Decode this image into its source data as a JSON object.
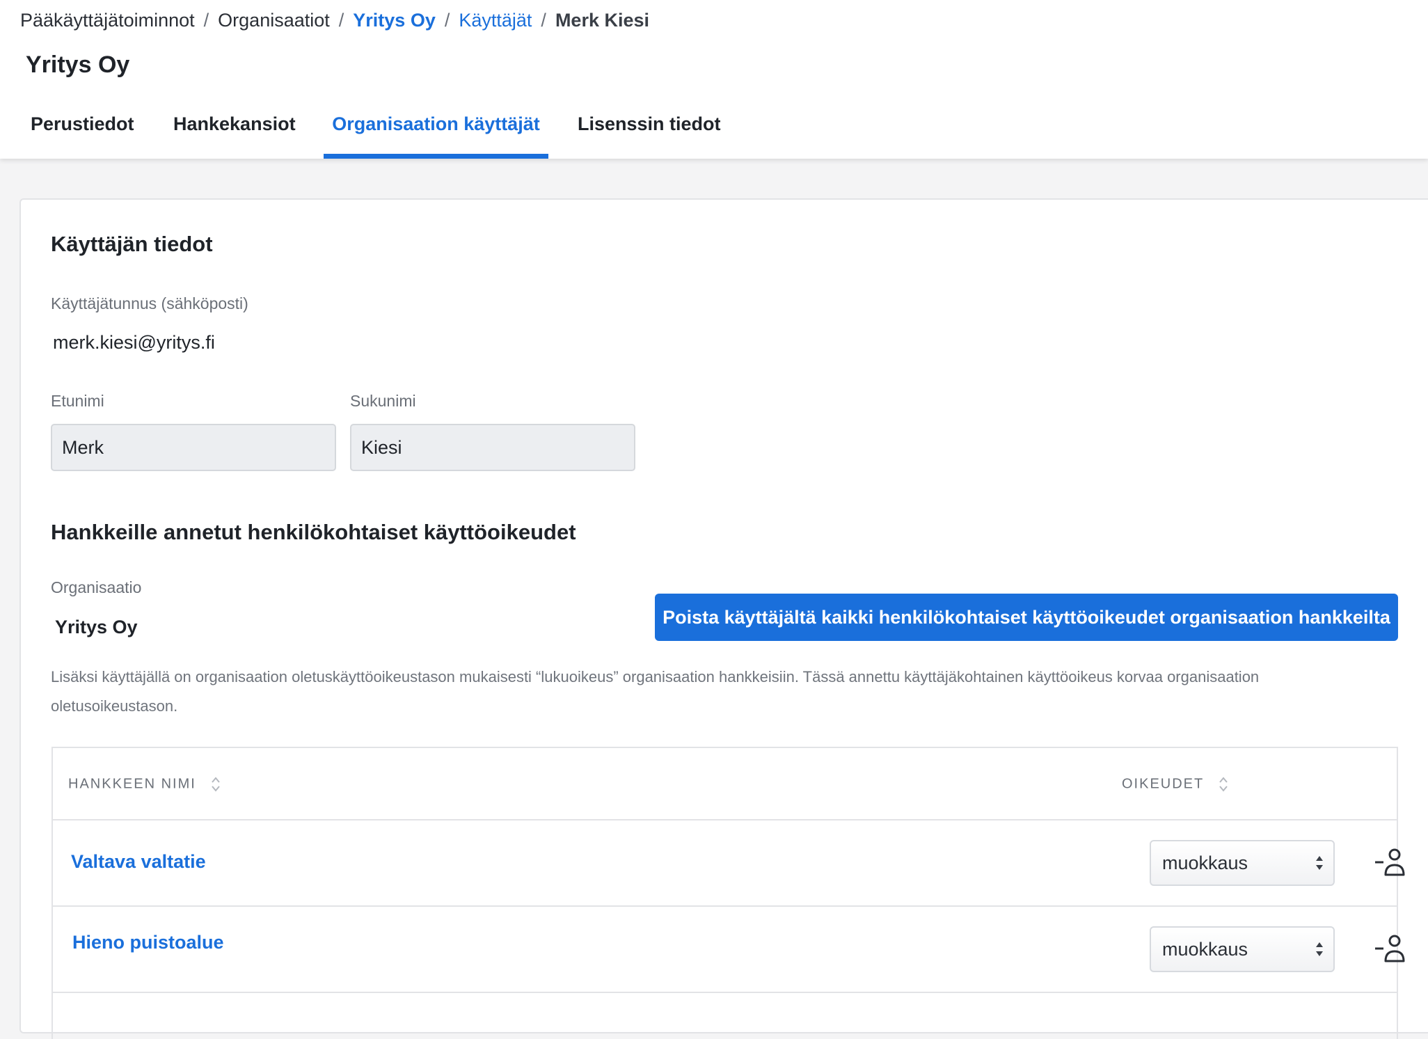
{
  "breadcrumb": {
    "items": [
      "Pääkäyttäjätoiminnot",
      "Organisaatiot",
      "Yritys Oy",
      "Käyttäjät",
      "Merk Kiesi"
    ],
    "separator": "/"
  },
  "organization": {
    "title": "Yritys Oy"
  },
  "tabs": [
    {
      "label": "Perustiedot"
    },
    {
      "label": "Hankekansiot"
    },
    {
      "label": "Organisaation käyttäjät"
    },
    {
      "label": "Lisenssin tiedot"
    }
  ],
  "active_tab": "Organisaation käyttäjät",
  "user_info": {
    "title": "Käyttäjän tiedot",
    "username_label": "Käyttäjätunnus (sähköposti)",
    "username_value": "merk.kiesi@yritys.fi",
    "first_name_label": "Etunimi",
    "first_name_value": "Merk",
    "last_name_label": "Sukunimi",
    "last_name_value": "Kiesi"
  },
  "permissions": {
    "title": "Hankkeille annetut henkilökohtaiset käyttöoikeudet",
    "org_label": "Organisaatio",
    "org_value": "Yritys Oy",
    "remove_all_button": "Poista käyttäjältä kaikki henkilökohtaiset käyttöoikeudet organisaation hankkeilta",
    "note": "Lisäksi käyttäjällä on organisaation oletuskäyttöoikeustason mukaisesti “lukuoikeus” organisaation hankkeisiin. Tässä annettu käyttäjäkohtainen käyttöoikeus korvaa organisaation oletusoikeustason.",
    "table": {
      "headers": {
        "name": "HANKKEEN NIMI",
        "rights": "OIKEUDET"
      },
      "rows": [
        {
          "name": "Valtava valtatie",
          "rights": "muokkaus"
        },
        {
          "name": "Hieno puistoalue",
          "rights": "muokkaus"
        }
      ]
    }
  },
  "colors": {
    "accent": "#1a6fdb",
    "muted_text": "#6a6f77",
    "border": "#e2e3e6",
    "page_bg": "#f4f4f5"
  },
  "icons": {
    "sort": "sort-icon",
    "select_arrows": "select-arrows-icon",
    "remove_user": "remove-user-icon"
  }
}
